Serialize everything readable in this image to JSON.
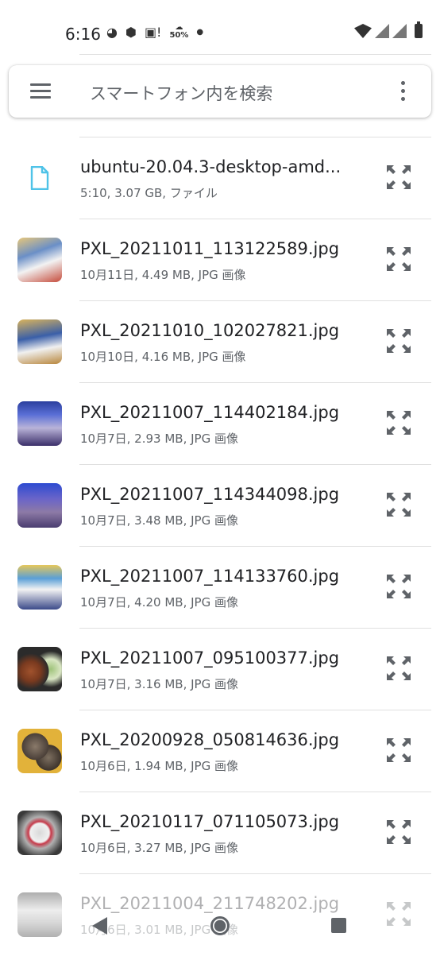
{
  "status_bar": {
    "time": "6:16",
    "battery_saver_label": "50%"
  },
  "search": {
    "placeholder": "スマートフォン内を検索"
  },
  "files": [
    {
      "name": "ubuntu-20.04.3-desktop-amd...",
      "meta": "5:10, 3.07 GB, ファイル",
      "type": "document"
    },
    {
      "name": "PXL_20211011_113122589.jpg",
      "meta": "10月11日, 4.49 MB, JPG 画像",
      "type": "image"
    },
    {
      "name": "PXL_20211010_102027821.jpg",
      "meta": "10月10日, 4.16 MB, JPG 画像",
      "type": "image"
    },
    {
      "name": "PXL_20211007_114402184.jpg",
      "meta": "10月7日, 2.93 MB, JPG 画像",
      "type": "image"
    },
    {
      "name": "PXL_20211007_114344098.jpg",
      "meta": "10月7日, 3.48 MB, JPG 画像",
      "type": "image"
    },
    {
      "name": "PXL_20211007_114133760.jpg",
      "meta": "10月7日, 4.20 MB, JPG 画像",
      "type": "image"
    },
    {
      "name": "PXL_20211007_095100377.jpg",
      "meta": "10月7日, 3.16 MB, JPG 画像",
      "type": "image"
    },
    {
      "name": "PXL_20200928_050814636.jpg",
      "meta": "10月6日, 1.94 MB, JPG 画像",
      "type": "image"
    },
    {
      "name": "PXL_20210117_071105073.jpg",
      "meta": "10月6日, 3.27 MB, JPG 画像",
      "type": "image"
    },
    {
      "name": "PXL_20211004_211748202.jpg",
      "meta": "10月6日, 3.01 MB, JPG 画像",
      "type": "image"
    }
  ],
  "colors": {
    "doc_icon": "#4fc3e8",
    "divider": "#e0e0e0",
    "text_secondary": "#5f6368"
  }
}
